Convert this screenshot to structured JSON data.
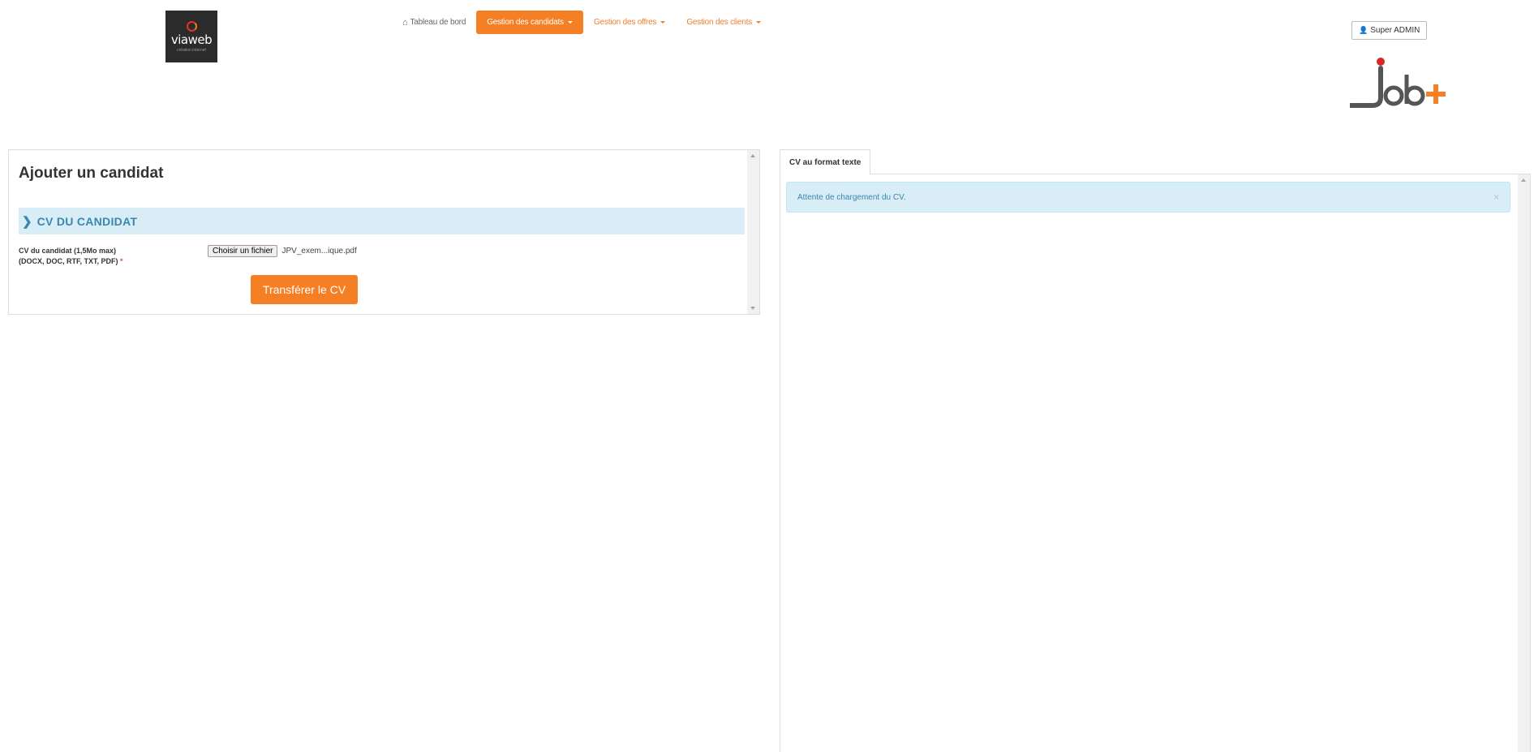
{
  "header": {
    "logo_left": {
      "wordmark": "viaweb",
      "tagline": "création internet"
    },
    "nav": [
      {
        "label": "Tableau de bord",
        "icon": "home-icon"
      },
      {
        "label": "Gestion des candidats",
        "active": true
      },
      {
        "label": "Gestion des offres"
      },
      {
        "label": "Gestion des clients"
      }
    ],
    "user_label": "Super ADMIN",
    "logo_right": {
      "text": "Job+"
    }
  },
  "form": {
    "title": "Ajouter un candidat",
    "section_label": "CV DU CANDIDAT",
    "field_label_line1": "CV du candidat (1,5Mo max)",
    "field_label_line2": "(DOCX, DOC, RTF, TXT, PDF)",
    "required_marker": "*",
    "file_button": "Choisir un fichier",
    "file_name": "JPV_exem...ique.pdf",
    "submit_label": "Transférer le CV"
  },
  "preview": {
    "tab_label": "CV au format texte",
    "alert_text": "Attente de chargement du CV.",
    "close_symbol": "×"
  },
  "colors": {
    "accent": "#f47f24",
    "info_bg": "#d9edf7",
    "info_text": "#3a87ad"
  }
}
